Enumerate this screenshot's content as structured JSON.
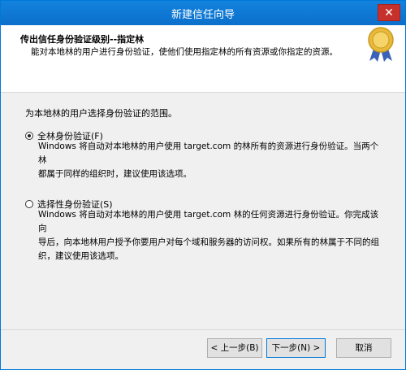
{
  "window": {
    "title": "新建信任向导",
    "close_glyph": "✕"
  },
  "header": {
    "title": "传出信任身份验证级别--指定林",
    "subtitle": "能对本地林的用户进行身份验证，使他们使用指定林的所有资源或你指定的资源。"
  },
  "main": {
    "prompt": "为本地林的用户选择身份验证的范围。",
    "options": [
      {
        "label": "全林身份验证(F)",
        "selected": true,
        "description_lines": [
          "Windows 将自动对本地林的用户使用 target.com 的林所有的资源进行身份验证。当两个林",
          "都属于同样的组织时，建议使用该选项。"
        ]
      },
      {
        "label": "选择性身份验证(S)",
        "selected": false,
        "description_lines": [
          "Windows 将自动对本地林的用户使用 target.com 林的任何资源进行身份验证。你完成该向",
          "导后，向本地林用户授予你要用户对每个域和服务器的访问权。如果所有的林属于不同的组",
          "织，建议使用该选项。"
        ]
      }
    ]
  },
  "footer": {
    "back_label": "< 上一步(B)",
    "next_label": "下一步(N) >",
    "cancel_label": "取消"
  },
  "icons": {
    "seal": "award-seal-icon"
  },
  "colors": {
    "titlebar": "#0b74d1",
    "close": "#c7312b",
    "seal_gold": "#e9b93a",
    "seal_ribbon": "#3a63b8"
  }
}
